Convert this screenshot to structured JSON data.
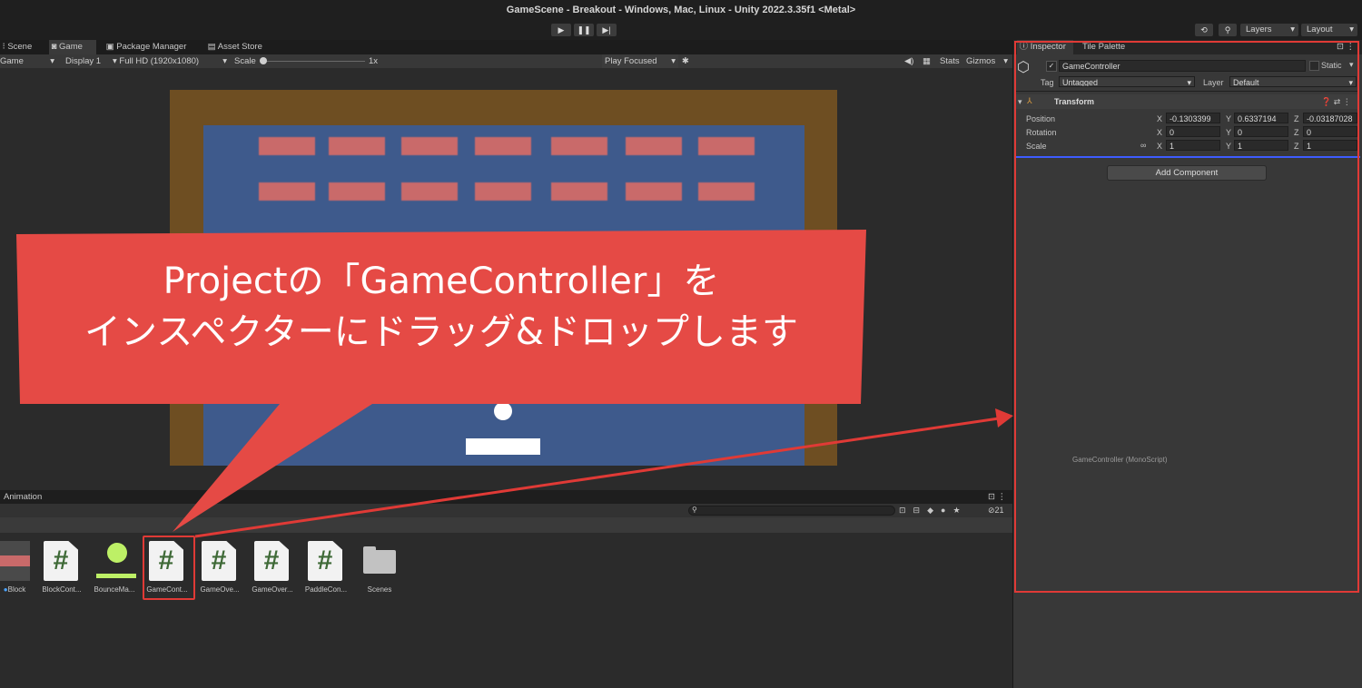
{
  "window": {
    "title": "GameScene - Breakout - Windows, Mac, Linux - Unity 2022.3.35f1 <Metal>"
  },
  "toolbar": {
    "play_icon": "play-icon",
    "pause_icon": "pause-icon",
    "step_icon": "step-icon",
    "history_icon": "history-icon",
    "search_icon": "search-icon",
    "layers": "Layers",
    "layout": "Layout"
  },
  "tabs": {
    "scene": "Scene",
    "game": "Game",
    "package_manager": "Package Manager",
    "asset_store": "Asset Store"
  },
  "gamebar": {
    "mode": "Game",
    "display": "Display 1",
    "resolution": "Full HD (1920x1080)",
    "scale_label": "Scale",
    "scale_value": "1x",
    "play_focused": "Play Focused",
    "stats": "Stats",
    "gizmos": "Gizmos"
  },
  "game": {
    "block_rows": 2,
    "blocks_per_row": 7
  },
  "bottom": {
    "animation_tab": "Animation",
    "count": "21",
    "assets": [
      {
        "label": "Block",
        "type": "prefab"
      },
      {
        "label": "BlockCont...",
        "type": "script"
      },
      {
        "label": "BounceMa...",
        "type": "material"
      },
      {
        "label": "GameCont...",
        "type": "script"
      },
      {
        "label": "GameOve...",
        "type": "script"
      },
      {
        "label": "GameOver...",
        "type": "script"
      },
      {
        "label": "PaddleCon...",
        "type": "script"
      },
      {
        "label": "Scenes",
        "type": "folder"
      }
    ],
    "script_glyph": "#"
  },
  "inspector": {
    "tab_inspector": "Inspector",
    "tab_tile_palette": "Tile Palette",
    "object_name": "GameController",
    "static_label": "Static",
    "tag_label": "Tag",
    "tag_value": "Untagged",
    "layer_label": "Layer",
    "layer_value": "Default",
    "transform_title": "Transform",
    "position_label": "Position",
    "rotation_label": "Rotation",
    "scale_label": "Scale",
    "axis_x": "X",
    "axis_y": "Y",
    "axis_z": "Z",
    "position": {
      "x": "-0.1303399",
      "y": "0.6337194",
      "z": "-0.03187028"
    },
    "rotation": {
      "x": "0",
      "y": "0",
      "z": "0"
    },
    "scale": {
      "x": "1",
      "y": "1",
      "z": "1"
    },
    "add_component": "Add Component",
    "drag_label": "GameController (MonoScript)"
  },
  "callout": {
    "line1": "Projectの「GameController」を",
    "line2": "インスペクターにドラッグ&ドロップします"
  },
  "colors": {
    "annotation_red": "#e03a36",
    "callout_fill": "#e54a45",
    "wall": "#6e4e22",
    "field": "#3e5a8c",
    "block": "#c96a6a",
    "script_icon_green": "#3f6a37",
    "drop_indicator_blue": "#3d5cff"
  }
}
